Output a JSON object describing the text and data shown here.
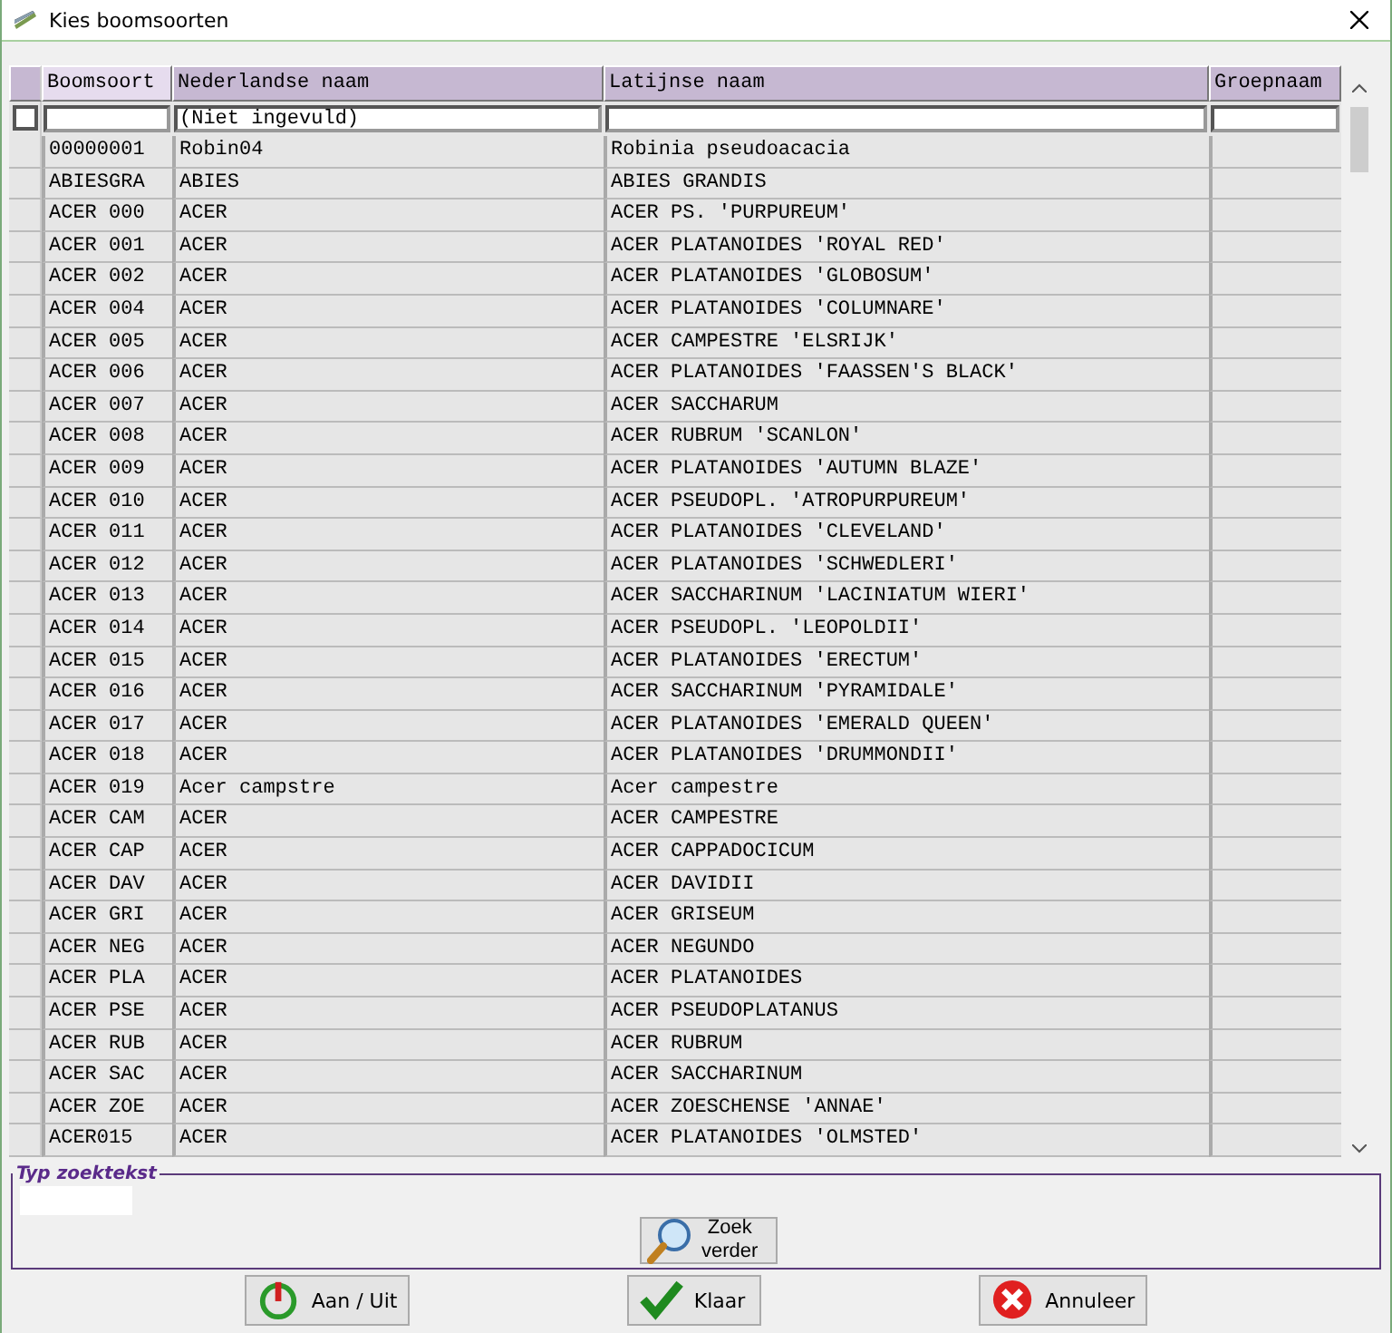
{
  "window": {
    "title": "Kies boomsoorten"
  },
  "table": {
    "columns": [
      {
        "label": "Boomsoort",
        "sorted": true
      },
      {
        "label": "Nederlandse naam",
        "sorted": false,
        "filter_placeholder": "(Niet ingevuld)"
      },
      {
        "label": "Latijnse naam",
        "sorted": false
      },
      {
        "label": "Groepnaam",
        "sorted": false
      }
    ],
    "filter_toggle": {
      "checked": false
    },
    "rows": [
      [
        "00000001",
        "Robin04",
        "Robinia pseudoacacia"
      ],
      [
        "ABIESGRA",
        "ABIES",
        "ABIES GRANDIS"
      ],
      [
        "ACER 000",
        "ACER",
        "ACER PS. 'PURPUREUM'"
      ],
      [
        "ACER 001",
        "ACER",
        "ACER PLATANOIDES 'ROYAL RED'"
      ],
      [
        "ACER 002",
        "ACER",
        "ACER PLATANOIDES 'GLOBOSUM'"
      ],
      [
        "ACER 004",
        "ACER",
        "ACER PLATANOIDES 'COLUMNARE'"
      ],
      [
        "ACER 005",
        "ACER",
        "ACER CAMPESTRE 'ELSRIJK'"
      ],
      [
        "ACER 006",
        "ACER",
        "ACER PLATANOIDES 'FAASSEN'S BLACK'"
      ],
      [
        "ACER 007",
        "ACER",
        "ACER SACCHARUM"
      ],
      [
        "ACER 008",
        "ACER",
        "ACER RUBRUM 'SCANLON'"
      ],
      [
        "ACER 009",
        "ACER",
        "ACER PLATANOIDES 'AUTUMN BLAZE'"
      ],
      [
        "ACER 010",
        "ACER",
        "ACER PSEUDOPL. 'ATROPURPUREUM'"
      ],
      [
        "ACER 011",
        "ACER",
        "ACER PLATANOIDES 'CLEVELAND'"
      ],
      [
        "ACER 012",
        "ACER",
        "ACER PLATANOIDES 'SCHWEDLERI'"
      ],
      [
        "ACER 013",
        "ACER",
        "ACER SACCHARINUM 'LACINIATUM WIERI'"
      ],
      [
        "ACER 014",
        "ACER",
        "ACER PSEUDOPL. 'LEOPOLDII'"
      ],
      [
        "ACER 015",
        "ACER",
        "ACER PLATANOIDES 'ERECTUM'"
      ],
      [
        "ACER 016",
        "ACER",
        "ACER SACCHARINUM 'PYRAMIDALE'"
      ],
      [
        "ACER 017",
        "ACER",
        "ACER PLATANOIDES 'EMERALD QUEEN'"
      ],
      [
        "ACER 018",
        "ACER",
        "ACER PLATANOIDES 'DRUMMONDII'"
      ],
      [
        "ACER 019",
        "Acer campstre",
        "Acer campestre"
      ],
      [
        "ACER CAM",
        "ACER",
        "ACER CAMPESTRE"
      ],
      [
        "ACER CAP",
        "ACER",
        "ACER CAPPADOCICUM"
      ],
      [
        "ACER DAV",
        "ACER",
        "ACER DAVIDII"
      ],
      [
        "ACER GRI",
        "ACER",
        "ACER GRISEUM"
      ],
      [
        "ACER NEG",
        "ACER",
        "ACER NEGUNDO"
      ],
      [
        "ACER PLA",
        "ACER",
        "ACER PLATANOIDES"
      ],
      [
        "ACER PSE",
        "ACER",
        "ACER PSEUDOPLATANUS"
      ],
      [
        "ACER RUB",
        "ACER",
        "ACER RUBRUM"
      ],
      [
        "ACER SAC",
        "ACER",
        "ACER SACCHARINUM"
      ],
      [
        "ACER ZOE",
        "ACER",
        "ACER ZOESCHENSE 'ANNAE'"
      ],
      [
        "ACER015",
        "ACER",
        "ACER PLATANOIDES 'OLMSTED'"
      ]
    ]
  },
  "search": {
    "legend": "Typ zoektekst",
    "button": [
      "Zoek",
      "verder"
    ]
  },
  "buttons": [
    {
      "kind": "power",
      "label": "Aan / Uit"
    },
    {
      "kind": "check",
      "label": "Klaar"
    },
    {
      "kind": "cancel",
      "label": "Annuleer"
    }
  ]
}
